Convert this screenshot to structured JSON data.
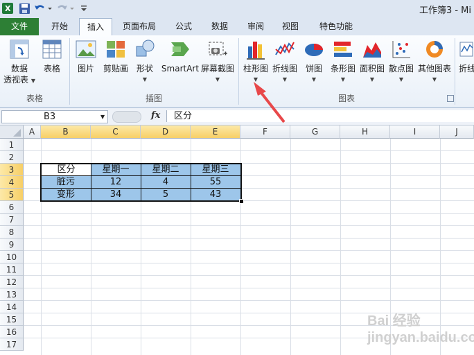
{
  "quick_access": {
    "excel_icon": "excel-icon",
    "save_icon": "save-icon",
    "undo_icon": "undo-icon",
    "redo_icon": "redo-icon",
    "customize_icon": "customize-icon"
  },
  "window": {
    "title": "工作簿3 - Mi"
  },
  "tabs": [
    {
      "label": "文件"
    },
    {
      "label": "开始"
    },
    {
      "label": "插入"
    },
    {
      "label": "页面布局"
    },
    {
      "label": "公式"
    },
    {
      "label": "数据"
    },
    {
      "label": "审阅"
    },
    {
      "label": "视图"
    },
    {
      "label": "特色功能"
    }
  ],
  "ribbon": {
    "pivot_label_1": "数据",
    "pivot_label_2": "透视表",
    "table_label": "表格",
    "group_tables": "表格",
    "picture_label": "图片",
    "clipart_label": "剪贴画",
    "shapes_label": "形状",
    "smartart_label": "SmartArt",
    "screenshot_label": "屏幕截图",
    "group_illustrations": "插图",
    "column_label": "柱形图",
    "line_label": "折线图",
    "pie_label": "饼图",
    "bar_label": "条形图",
    "area_label": "面积图",
    "scatter_label": "散点图",
    "other_label": "其他图表",
    "sparkline_label": "折线",
    "group_charts": "图表"
  },
  "formula_bar": {
    "name_box": "B3",
    "fx": "fx",
    "content": "区分"
  },
  "columns": [
    "A",
    "B",
    "C",
    "D",
    "E",
    "F",
    "G",
    "H",
    "I",
    "J"
  ],
  "rows": [
    "1",
    "2",
    "3",
    "4",
    "5",
    "6",
    "7",
    "8",
    "9",
    "10",
    "11",
    "12",
    "13",
    "14",
    "15",
    "16",
    "17"
  ],
  "table": {
    "header": [
      "区分",
      "星期一",
      "星期二",
      "星期三"
    ],
    "row1": [
      "脏污",
      "12",
      "4",
      "55"
    ],
    "row2": [
      "变形",
      "34",
      "5",
      "43"
    ]
  },
  "colors": {
    "selection_fill": "#9dc6ea",
    "file_tab": "#2d7f35",
    "arrow": "#e8484a"
  },
  "watermark": "Bai 经验 jingyan.baidu.com"
}
